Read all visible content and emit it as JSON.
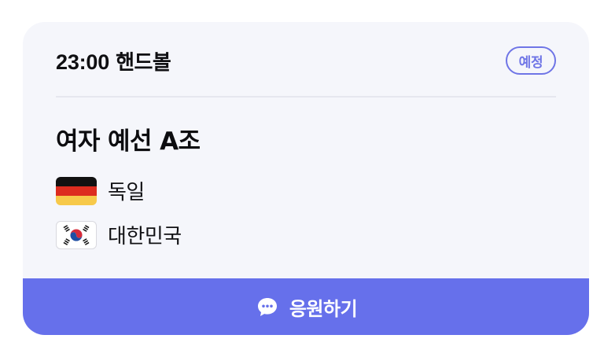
{
  "card": {
    "time": "23:00",
    "sport": "핸드볼",
    "status_badge": "예정",
    "title": "여자 예선 A조",
    "teams": [
      {
        "flag_icon": "germany-flag-icon",
        "name": "독일"
      },
      {
        "flag_icon": "south-korea-flag-icon",
        "name": "대한민국"
      }
    ],
    "cheer_button": {
      "icon": "speech-bubble-icon",
      "label": "응원하기"
    },
    "colors": {
      "card_background": "#f5f6fb",
      "accent": "#6670eb",
      "badge": "#6f75e6",
      "text": "#0f0f12"
    }
  }
}
